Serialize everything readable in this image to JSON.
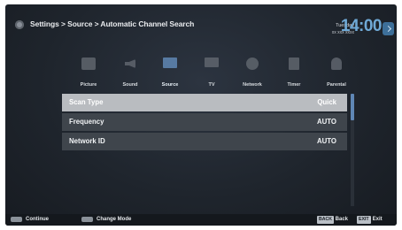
{
  "header": {
    "breadcrumb": "Settings > Source > Automatic Channel Search",
    "day": "Tuesday",
    "date": "xx xxx xxxx",
    "time": "14:00"
  },
  "tabs": [
    {
      "label": "Picture",
      "icon": "picture-icon",
      "active": false
    },
    {
      "label": "Sound",
      "icon": "speaker-icon",
      "active": false
    },
    {
      "label": "Source",
      "icon": "antenna-icon",
      "active": true
    },
    {
      "label": "TV",
      "icon": "tv-icon",
      "active": false
    },
    {
      "label": "Network",
      "icon": "globe-icon",
      "active": false
    },
    {
      "label": "Timer",
      "icon": "timer-icon",
      "active": false
    },
    {
      "label": "Parental",
      "icon": "lock-icon",
      "active": false
    }
  ],
  "settings": [
    {
      "name": "Scan Type",
      "value": "Quick",
      "selected": true
    },
    {
      "name": "Frequency",
      "value": "AUTO",
      "selected": false
    },
    {
      "name": "Network ID",
      "value": "AUTO",
      "selected": false
    }
  ],
  "footer": {
    "continue_label": "Continue",
    "change_mode_label": "Change Mode",
    "back_key": "BACK",
    "back_label": "- Back",
    "exit_key": "EXIT",
    "exit_label": "- Exit"
  },
  "colors": {
    "accent": "#5f87b5",
    "selected_row": "#b9bcc0",
    "row": "#3f454c"
  }
}
